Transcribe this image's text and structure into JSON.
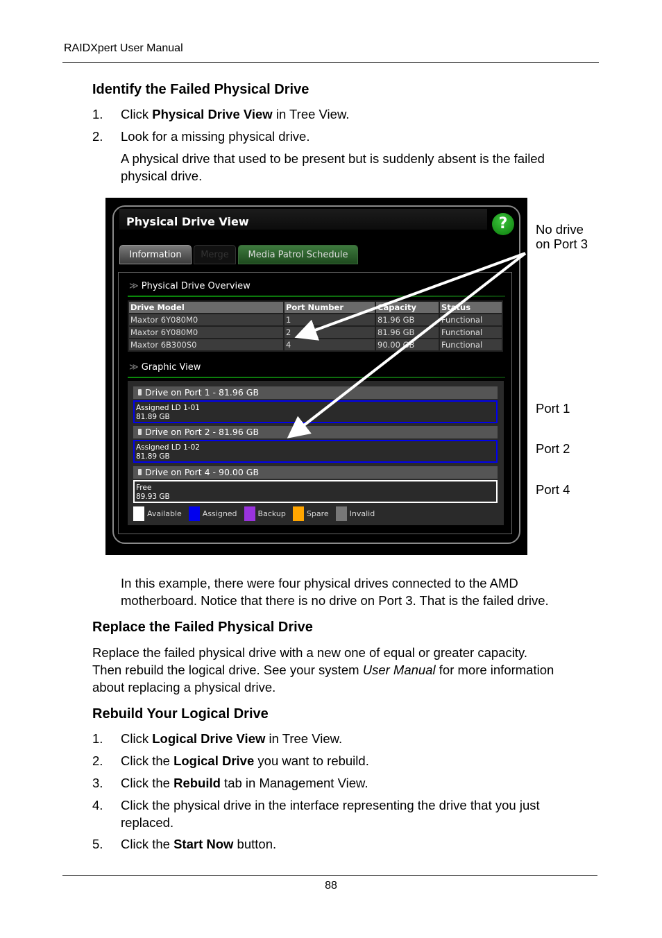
{
  "header": {
    "title": "RAIDXpert User Manual"
  },
  "sections": [
    {
      "heading": "Identify the Failed Physical Drive",
      "steps": [
        {
          "num": "1.",
          "pre": "Click ",
          "bold": "Physical Drive View",
          "post": " in Tree View."
        },
        {
          "num": "2.",
          "text": "Look for a missing physical drive."
        }
      ],
      "note_lines": [
        "A physical drive that used to be present but is suddenly absent is the failed",
        "physical drive."
      ]
    },
    {
      "heading": "Replace the Failed Physical Drive",
      "para_line1": "Replace the failed physical drive with a new one of equal or greater capacity.",
      "para_line2_pre": "Then rebuild the logical drive. See your system ",
      "para_line2_italic": "User Manual",
      "para_line2_post": " for more information",
      "para_line3": "about replacing a physical drive."
    },
    {
      "heading": "Rebuild Your Logical Drive",
      "steps": [
        {
          "num": "1.",
          "pre": "Click ",
          "bold": "Logical Drive View",
          "post": " in Tree View."
        },
        {
          "num": "2.",
          "pre": "Click the ",
          "bold": "Logical Drive",
          "post": " you want to rebuild."
        },
        {
          "num": "3.",
          "pre": "Click the ",
          "bold": "Rebuild",
          "post": " tab in Management View."
        },
        {
          "num": "4.",
          "line1": "Click the physical drive in the interface representing the drive that you just",
          "line2": "replaced."
        },
        {
          "num": "5.",
          "pre": "Click the ",
          "bold": "Start Now",
          "post": " button."
        }
      ]
    }
  ],
  "example_lines": [
    "In this example, there were four physical drives connected to the AMD",
    "motherboard. Notice that there is no drive on Port 3. That is the failed drive."
  ],
  "screenshot": {
    "panel_title": "Physical Drive View",
    "help_icon": "?",
    "tabs": [
      "Information",
      "Merge",
      "Media Patrol Schedule"
    ],
    "overview_label": "Physical Drive Overview",
    "table": {
      "headers": [
        "Drive Model",
        "Port Number",
        "Capacity",
        "Status"
      ],
      "rows": [
        [
          "Maxtor 6Y080M0",
          "1",
          "81.96 GB",
          "Functional"
        ],
        [
          "Maxtor 6Y080M0",
          "2",
          "81.96 GB",
          "Functional"
        ],
        [
          "Maxtor 6B300S0",
          "4",
          "90.00 GB",
          "Functional"
        ]
      ]
    },
    "graphic_label": "Graphic View",
    "drives": [
      {
        "title": "Drive on Port 1 - 81.96 GB",
        "line1": "Assigned LD 1-01",
        "line2": "81.89 GB"
      },
      {
        "title": "Drive on Port 2 - 81.96 GB",
        "line1": "Assigned LD 1-02",
        "line2": "81.89 GB"
      },
      {
        "title": "Drive on Port 4 - 90.00 GB",
        "line1": "Free",
        "line2": "89.93 GB"
      }
    ],
    "legend": [
      {
        "label": "Available",
        "color": "#ffffff"
      },
      {
        "label": "Assigned",
        "color": "#0000ee"
      },
      {
        "label": "Backup",
        "color": "#9933dd"
      },
      {
        "label": "Spare",
        "color": "#ffa500"
      },
      {
        "label": "Invalid",
        "color": "#777777"
      }
    ]
  },
  "callouts": {
    "no_drive_line1": "No drive",
    "no_drive_line2": "on Port 3",
    "port1": "Port 1",
    "port2": "Port 2",
    "port4": "Port 4"
  },
  "footer": {
    "page_number": "88"
  }
}
